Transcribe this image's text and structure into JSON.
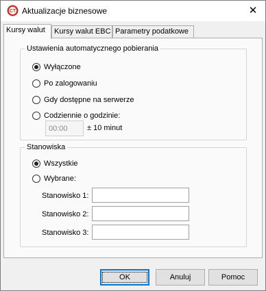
{
  "window": {
    "title": "Aktualizacje biznesowe"
  },
  "tabs": [
    {
      "label": "Kursy walut",
      "active": true
    },
    {
      "label": "Kursy walut EBC",
      "active": false
    },
    {
      "label": "Parametry podatkowe",
      "active": false
    }
  ],
  "auto_download": {
    "title": "Ustawienia automatycznego pobierania",
    "options": [
      {
        "label": "Wyłączone",
        "checked": true
      },
      {
        "label": "Po zalogowaniu",
        "checked": false
      },
      {
        "label": "Gdy dostępne na serwerze",
        "checked": false
      },
      {
        "label": "Codziennie o godzinie:",
        "checked": false
      }
    ],
    "time_value": "00:00",
    "tolerance_label": "± 10 minut"
  },
  "stations": {
    "title": "Stanowiska",
    "options": [
      {
        "label": "Wszystkie",
        "checked": true
      },
      {
        "label": "Wybrane:",
        "checked": false
      }
    ],
    "fields": [
      {
        "label": "Stanowisko 1:",
        "value": ""
      },
      {
        "label": "Stanowisko 2:",
        "value": ""
      },
      {
        "label": "Stanowisko 3:",
        "value": ""
      }
    ]
  },
  "buttons": {
    "ok": "OK",
    "cancel": "Anuluj",
    "help": "Pomoc"
  },
  "colors": {
    "accent": "#0078d7",
    "window_bg": "#f0f0f0",
    "panel_bg": "#fafafa"
  }
}
